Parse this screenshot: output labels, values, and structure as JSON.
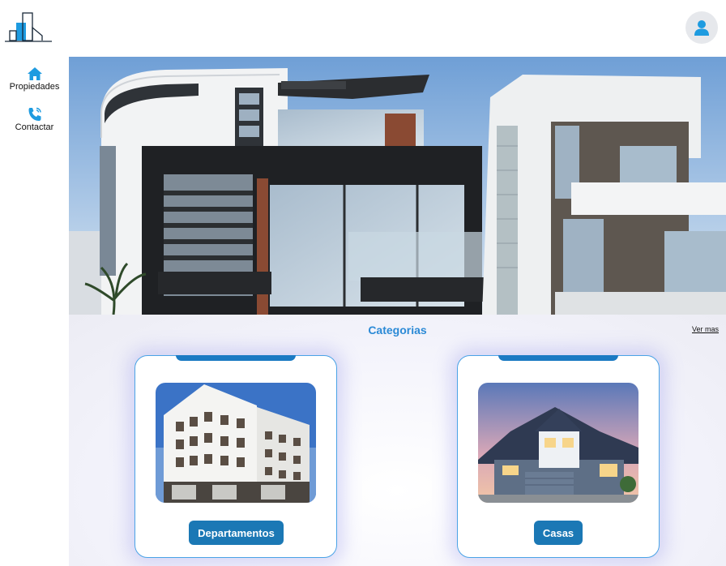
{
  "sidebar": {
    "items": [
      {
        "label": "Propiedades",
        "icon": "home-icon"
      },
      {
        "label": "Contactar",
        "icon": "phone-icon"
      }
    ]
  },
  "header": {
    "user_icon": "user-icon"
  },
  "categories": {
    "title": "Categorias",
    "more_link": "Ver mas",
    "cards": [
      {
        "label": "Departamentos",
        "image": "apartment-building-image"
      },
      {
        "label": "Casas",
        "image": "house-image"
      }
    ]
  },
  "colors": {
    "accent": "#1b78b5",
    "accent_light": "#2b8ad6",
    "icon_blue": "#1e9be0",
    "card_border": "#4aa3e6"
  }
}
